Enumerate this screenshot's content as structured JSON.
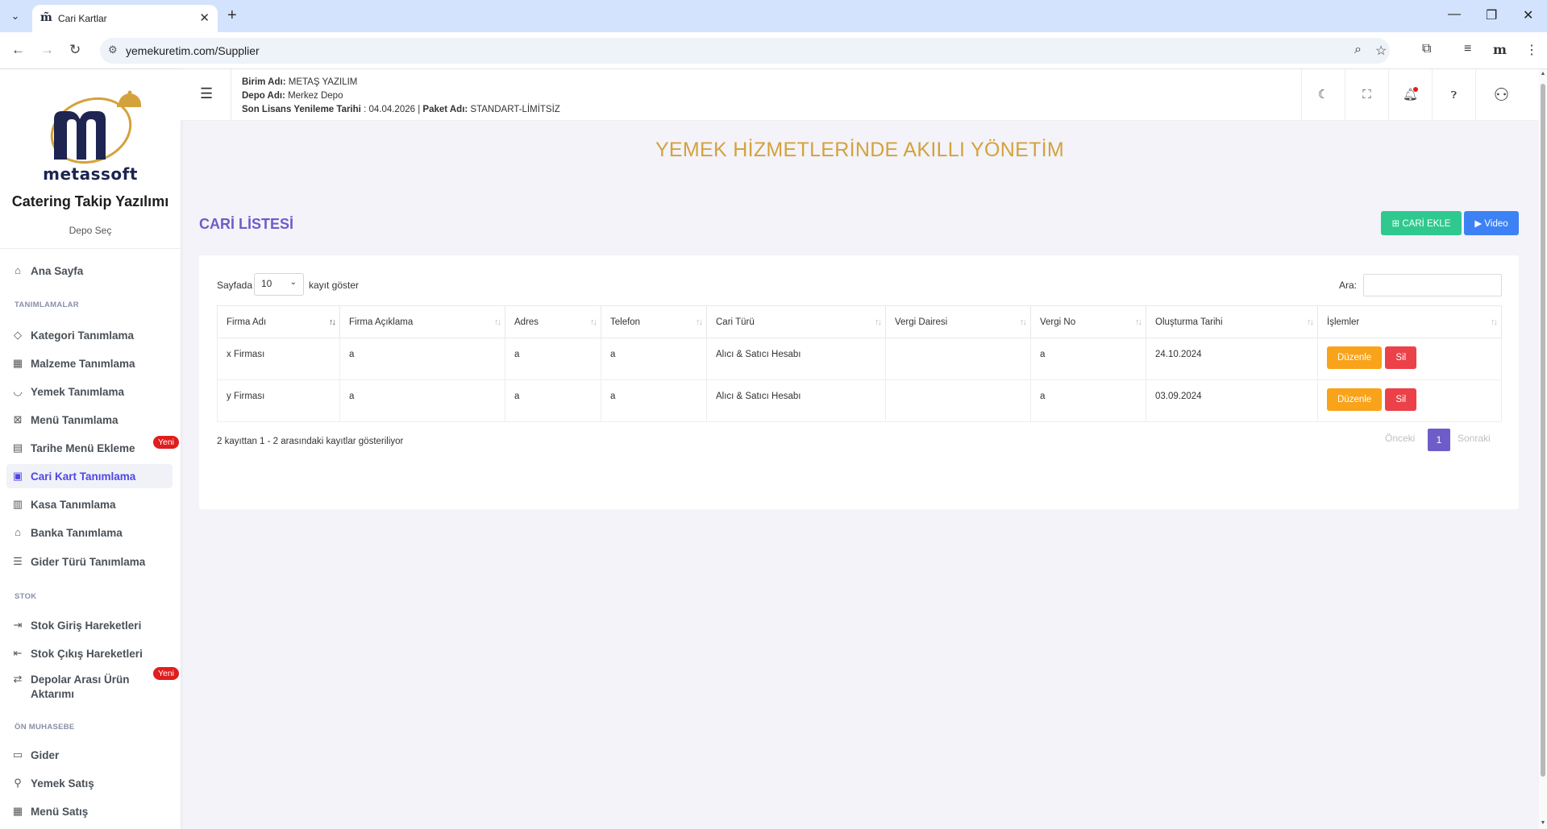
{
  "browser": {
    "tab_title": "Cari Kartlar",
    "tab_favicon": "m̃",
    "url": "yemekuretim.com/Supplier",
    "icons": [
      "tab-list-icon",
      "close-icon",
      "plus-icon",
      "minimize-icon",
      "restore-icon",
      "close-window-icon",
      "back-icon",
      "forward-icon",
      "reload-icon",
      "site-settings-icon",
      "zoom-icon",
      "star-icon",
      "extensions-icon",
      "playlist-icon",
      "profile-icon",
      "menu-icon"
    ]
  },
  "sidebar": {
    "brand": "metassoft",
    "app_name": "Catering Takip Yazılımı",
    "depot_select": "Depo Seç",
    "home": "Ana Sayfa",
    "section_definitions": "TANIMLAMALAR",
    "items_definitions": [
      {
        "label": "Kategori Tanımlama",
        "icon": "tag-icon"
      },
      {
        "label": "Malzeme Tanımlama",
        "icon": "box-icon"
      },
      {
        "label": "Yemek Tanımlama",
        "icon": "bowl-icon"
      },
      {
        "label": "Menü Tanımlama",
        "icon": "menu-grid-icon"
      },
      {
        "label": "Tarihe Menü Ekleme",
        "icon": "calendar-icon",
        "badge": "Yeni"
      },
      {
        "label": "Cari Kart Tanımlama",
        "icon": "contact-card-icon",
        "active": true
      },
      {
        "label": "Kasa Tanımlama",
        "icon": "cash-register-icon"
      },
      {
        "label": "Banka Tanımlama",
        "icon": "bank-icon"
      },
      {
        "label": "Gider Türü Tanımlama",
        "icon": "list-icon"
      }
    ],
    "section_stock": "STOK",
    "items_stock": [
      {
        "label": "Stok Giriş Hareketleri",
        "icon": "stock-in-icon"
      },
      {
        "label": "Stok Çıkış Hareketleri",
        "icon": "stock-out-icon"
      },
      {
        "label": "Depolar Arası Ürün Aktarımı",
        "icon": "transfer-icon",
        "badge": "Yeni"
      }
    ],
    "section_accounting": "ÖN MUHASEBE",
    "items_accounting": [
      {
        "label": "Gider",
        "icon": "wallet-icon"
      },
      {
        "label": "Yemek Satış",
        "icon": "food-sale-icon"
      },
      {
        "label": "Menü Satış",
        "icon": "menu-sale-icon"
      }
    ]
  },
  "header": {
    "unit_label": "Birim Adı:",
    "unit_value": "METAŞ YAZILIM",
    "depot_label": "Depo Adı:",
    "depot_value": "Merkez Depo",
    "license_label": "Son Lisans Yenileme Tarihi",
    "license_value": ": 04.04.2026 |",
    "package_label": "Paket Adı:",
    "package_value": "STANDART-LİMİTSİZ"
  },
  "main": {
    "banner": "YEMEK HİZMETLERİNDE AKILLI YÖNETİM",
    "title": "CARİ LİSTESİ",
    "add_button": "CARİ EKLE",
    "video_button": "Video",
    "length_prefix": "Sayfada",
    "length_value": "10",
    "length_suffix": "kayıt göster",
    "search_label": "Ara:",
    "columns": [
      "Firma Adı",
      "Firma Açıklama",
      "Adres",
      "Telefon",
      "Cari Türü",
      "Vergi Dairesi",
      "Vergi No",
      "Oluşturma Tarihi",
      "İşlemler"
    ],
    "rows": [
      [
        "x Firması",
        "a",
        "a",
        "a",
        "Alıcı & Satıcı Hesabı",
        "",
        "a",
        "24.10.2024"
      ],
      [
        "y Firması",
        "a",
        "a",
        "a",
        "Alıcı & Satıcı Hesabı",
        "",
        "a",
        "03.09.2024"
      ]
    ],
    "edit_label": "Düzenle",
    "delete_label": "Sil",
    "info": "2 kayıttan 1 - 2 arasındaki kayıtlar gösteriliyor",
    "prev": "Önceki",
    "page": "1",
    "next": "Sonraki"
  },
  "colors": {
    "accent": "#6e5cc9",
    "banner": "#d4a23c",
    "success": "#2fc98f",
    "primary": "#3d82f5",
    "warning": "#f9a31a",
    "danger": "#ec4149"
  }
}
